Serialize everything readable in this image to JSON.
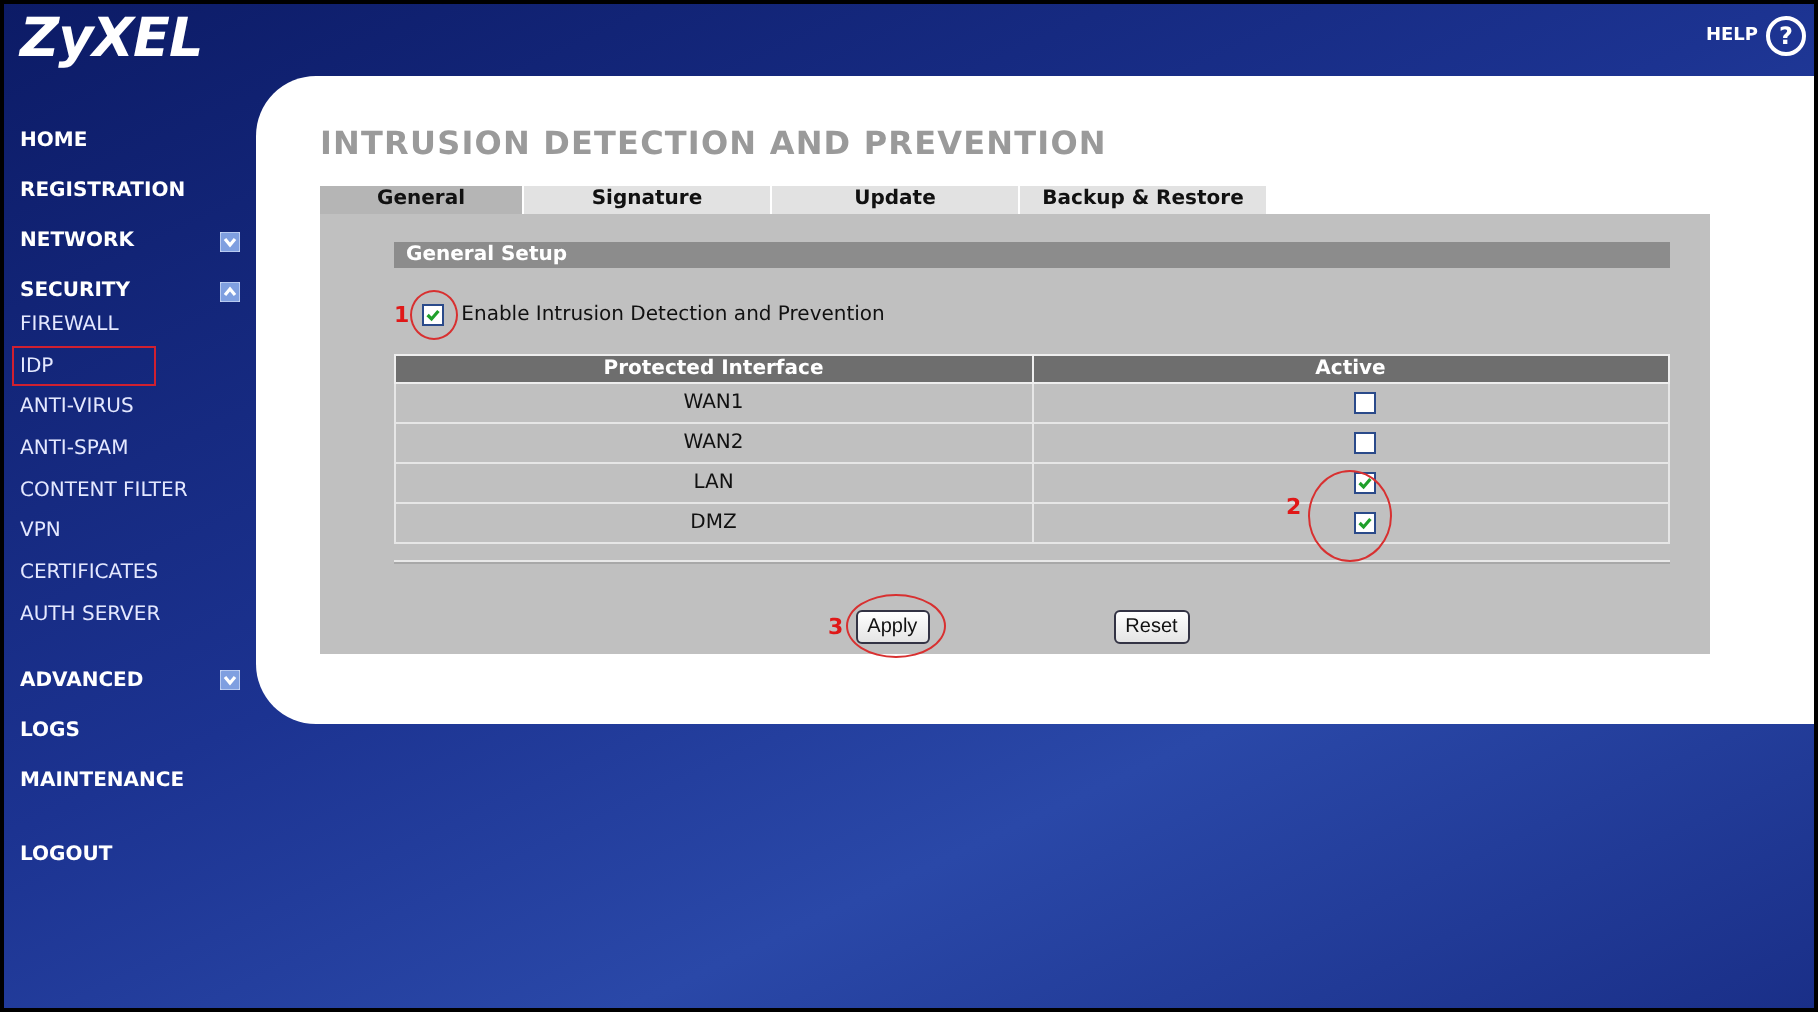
{
  "header": {
    "logo": "ZyXEL",
    "help": "HELP",
    "help_icon": "?"
  },
  "sidebar": {
    "items": [
      {
        "label": "HOME",
        "kind": "section",
        "selected": false
      },
      {
        "label": "REGISTRATION",
        "kind": "section",
        "selected": false
      },
      {
        "label": "NETWORK",
        "kind": "section",
        "selected": false,
        "expanded": false
      },
      {
        "label": "SECURITY",
        "kind": "section",
        "selected": false,
        "expanded": true
      },
      {
        "label": "FIREWALL",
        "kind": "sub",
        "selected": false
      },
      {
        "label": "IDP",
        "kind": "sub",
        "selected": true
      },
      {
        "label": "ANTI-VIRUS",
        "kind": "sub",
        "selected": false
      },
      {
        "label": "ANTI-SPAM",
        "kind": "sub",
        "selected": false
      },
      {
        "label": "CONTENT FILTER",
        "kind": "sub",
        "selected": false
      },
      {
        "label": "VPN",
        "kind": "sub",
        "selected": false
      },
      {
        "label": "CERTIFICATES",
        "kind": "sub",
        "selected": false
      },
      {
        "label": "AUTH SERVER",
        "kind": "sub",
        "selected": false
      },
      {
        "label": "ADVANCED",
        "kind": "section",
        "selected": false,
        "expanded": false
      },
      {
        "label": "LOGS",
        "kind": "section",
        "selected": false
      },
      {
        "label": "MAINTENANCE",
        "kind": "section",
        "selected": false
      },
      {
        "label": "LOGOUT",
        "kind": "section",
        "selected": false
      }
    ]
  },
  "page": {
    "title": "INTRUSION DETECTION AND PREVENTION"
  },
  "tabs": [
    {
      "label": "General",
      "selected": true
    },
    {
      "label": "Signature",
      "selected": false
    },
    {
      "label": "Update",
      "selected": false
    },
    {
      "label": "Backup & Restore",
      "selected": false
    }
  ],
  "general_setup": {
    "heading": "General Setup",
    "enable": {
      "label": "Enable Intrusion Detection and Prevention",
      "checked": true,
      "annotation": "1"
    }
  },
  "table": {
    "columns": [
      "Protected Interface",
      "Active"
    ],
    "annotation": "2",
    "rows": [
      {
        "interface": "WAN1",
        "active": false
      },
      {
        "interface": "WAN2",
        "active": false
      },
      {
        "interface": "LAN",
        "active": true
      },
      {
        "interface": "DMZ",
        "active": true
      }
    ]
  },
  "buttons": [
    {
      "label": "Apply",
      "annotation": "3"
    },
    {
      "label": "Reset"
    }
  ]
}
